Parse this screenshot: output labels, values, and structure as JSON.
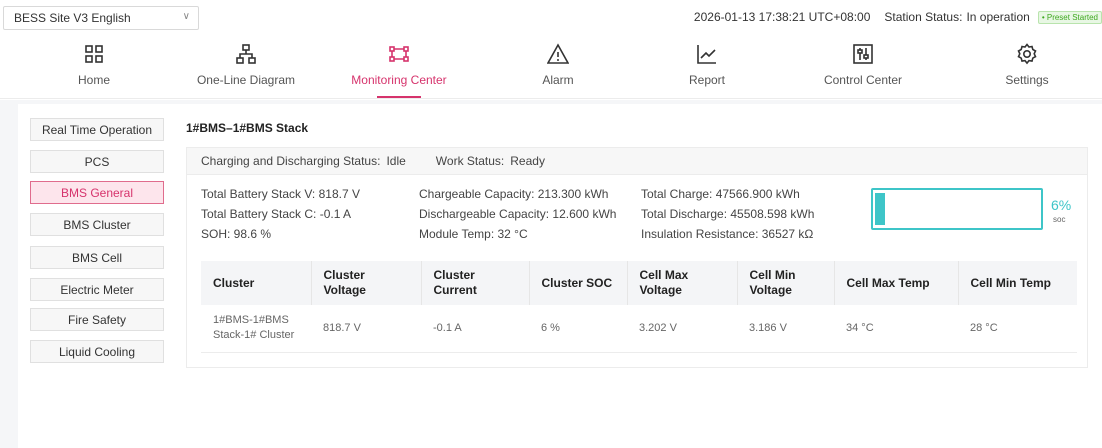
{
  "topbar": {
    "site_name": "BESS Site V3 English",
    "datetime": "2026-01-13 17:38:21 UTC+08:00",
    "station_status_label": "Station Status:",
    "station_status_value": "In operation",
    "preset_badge": "• Preset Started"
  },
  "nav": {
    "items": [
      {
        "label": "Home",
        "icon": "grid-icon"
      },
      {
        "label": "One-Line Diagram",
        "icon": "topology-icon"
      },
      {
        "label": "Monitoring Center",
        "icon": "monitor-icon",
        "active": true
      },
      {
        "label": "Alarm",
        "icon": "warning-icon"
      },
      {
        "label": "Report",
        "icon": "line-chart-icon"
      },
      {
        "label": "Control Center",
        "icon": "sliders-icon"
      },
      {
        "label": "Settings",
        "icon": "gear-icon"
      }
    ]
  },
  "sidebar": {
    "items": [
      {
        "label": "Real Time Operation"
      },
      {
        "label": "PCS"
      },
      {
        "label": "BMS General",
        "active": true
      },
      {
        "label": "BMS Cluster"
      },
      {
        "label": "BMS Cell"
      },
      {
        "label": "Electric Meter"
      },
      {
        "label": "Fire Safety"
      },
      {
        "label": "Liquid Cooling"
      }
    ]
  },
  "panel": {
    "title": "1#BMS–1#BMS Stack",
    "status": {
      "charging_label": "Charging and Discharging Status:",
      "charging_value": "Idle",
      "work_label": "Work Status:",
      "work_value": "Ready"
    },
    "metrics": {
      "total_v": "Total Battery Stack V:  818.7 V",
      "total_c": "Total Battery Stack C:  -0.1 A",
      "soh": "SOH:  98.6 %",
      "chargeable": "Chargeable Capacity:  213.300 kWh",
      "dischargeable": "Dischargeable Capacity:  12.600 kWh",
      "module_temp": "Module Temp:  32 °C",
      "total_charge": "Total Charge:  47566.900 kWh",
      "total_discharge": "Total Discharge:  45508.598 kWh",
      "insulation": "Insulation Resistance:  36527 kΩ"
    },
    "soc": {
      "value": 0.06,
      "percent_text": "6%",
      "label": "soc",
      "color": "#3ec5c8"
    },
    "table": {
      "headers": [
        "Cluster",
        "Cluster Voltage",
        "Cluster Current",
        "Cluster SOC",
        "Cell Max Voltage",
        "Cell Min Voltage",
        "Cell Max Temp",
        "Cell Min Temp"
      ],
      "rows": [
        [
          "1#BMS-1#BMS Stack-1# Cluster",
          "818.7 V",
          "-0.1 A",
          "6 %",
          "3.202 V",
          "3.186 V",
          "34 °C",
          "28 °C"
        ]
      ]
    }
  },
  "colors": {
    "accent": "#d6336c",
    "soc": "#3ec5c8"
  }
}
